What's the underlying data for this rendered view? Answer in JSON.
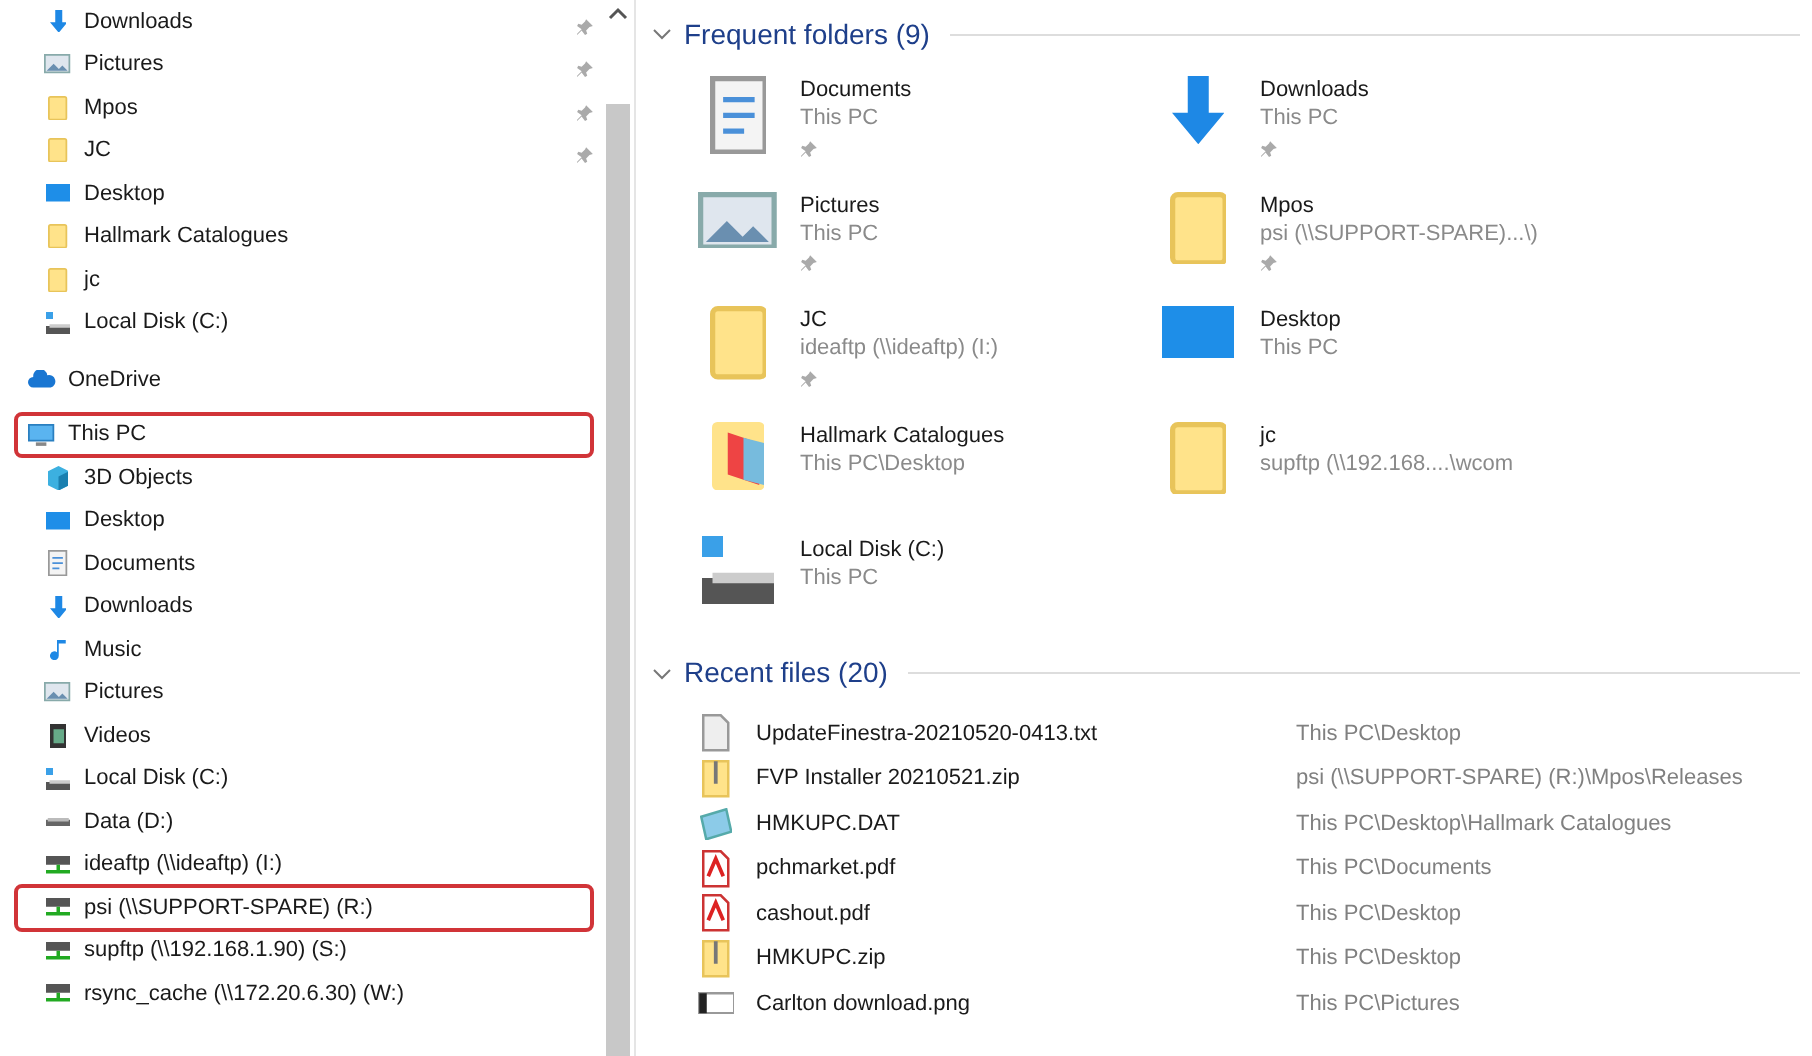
{
  "sidebar": {
    "quick_access": [
      {
        "label": "Downloads",
        "kind": "download",
        "pinned": true
      },
      {
        "label": "Pictures",
        "kind": "pictures",
        "pinned": true
      },
      {
        "label": "Mpos",
        "kind": "folder",
        "pinned": true
      },
      {
        "label": "JC",
        "kind": "folder",
        "pinned": true
      },
      {
        "label": "Desktop",
        "kind": "desktop",
        "pinned": false
      },
      {
        "label": "Hallmark Catalogues",
        "kind": "folder",
        "pinned": false
      },
      {
        "label": "jc",
        "kind": "folder",
        "pinned": false
      },
      {
        "label": "Local Disk (C:)",
        "kind": "disk",
        "pinned": false
      }
    ],
    "items": [
      {
        "label": "OneDrive",
        "kind": "cloud",
        "highlighted": false
      },
      {
        "label": "This PC",
        "kind": "pc",
        "highlighted": true,
        "children": [
          {
            "label": "3D Objects",
            "kind": "cube",
            "highlighted": false
          },
          {
            "label": "Desktop",
            "kind": "desktop",
            "highlighted": false
          },
          {
            "label": "Documents",
            "kind": "documents",
            "highlighted": false
          },
          {
            "label": "Downloads",
            "kind": "download",
            "highlighted": false
          },
          {
            "label": "Music",
            "kind": "music",
            "highlighted": false
          },
          {
            "label": "Pictures",
            "kind": "pictures",
            "highlighted": false
          },
          {
            "label": "Videos",
            "kind": "videos",
            "highlighted": false
          },
          {
            "label": "Local Disk (C:)",
            "kind": "disk",
            "highlighted": false
          },
          {
            "label": "Data (D:)",
            "kind": "drive",
            "highlighted": false
          },
          {
            "label": "ideaftp (\\\\ideaftp) (I:)",
            "kind": "netdrive",
            "highlighted": false
          },
          {
            "label": "psi (\\\\SUPPORT-SPARE) (R:)",
            "kind": "netdrive",
            "highlighted": true
          },
          {
            "label": "supftp (\\\\192.168.1.90) (S:)",
            "kind": "netdrive",
            "highlighted": false
          },
          {
            "label": "rsync_cache (\\\\172.20.6.30) (W:)",
            "kind": "netdrive",
            "highlighted": false
          }
        ]
      }
    ]
  },
  "frequent_folders": {
    "title": "Frequent folders (9)",
    "expanded": true,
    "items": [
      {
        "name": "Documents",
        "location": "This PC",
        "pinned": true,
        "kind": "documents"
      },
      {
        "name": "Downloads",
        "location": "This PC",
        "pinned": true,
        "kind": "download"
      },
      {
        "name": "Pictures",
        "location": "This PC",
        "pinned": true,
        "kind": "pictures"
      },
      {
        "name": "Mpos",
        "location": "psi (\\\\SUPPORT-SPARE)...\\)",
        "pinned": true,
        "kind": "folder"
      },
      {
        "name": "JC",
        "location": "ideaftp (\\\\ideaftp) (I:)",
        "pinned": true,
        "kind": "folder"
      },
      {
        "name": "Desktop",
        "location": "This PC",
        "pinned": false,
        "kind": "desktop"
      },
      {
        "name": "Hallmark Catalogues",
        "location": "This PC\\Desktop",
        "pinned": false,
        "kind": "book"
      },
      {
        "name": "jc",
        "location": "supftp (\\\\192.168....\\wcom",
        "pinned": false,
        "kind": "folder"
      },
      {
        "name": "Local Disk (C:)",
        "location": "This PC",
        "pinned": false,
        "kind": "disk"
      }
    ]
  },
  "recent_files": {
    "title": "Recent files (20)",
    "expanded": true,
    "items": [
      {
        "name": "UpdateFinestra-20210520-0413.txt",
        "location": "This PC\\Desktop",
        "kind": "txt"
      },
      {
        "name": "FVP Installer 20210521.zip",
        "location": "psi (\\\\SUPPORT-SPARE) (R:)\\Mpos\\Releases",
        "kind": "zip"
      },
      {
        "name": "HMKUPC.DAT",
        "location": "This PC\\Desktop\\Hallmark Catalogues",
        "kind": "dat"
      },
      {
        "name": "pchmarket.pdf",
        "location": "This PC\\Documents",
        "kind": "pdf"
      },
      {
        "name": "cashout.pdf",
        "location": "This PC\\Desktop",
        "kind": "pdf"
      },
      {
        "name": "HMKUPC.zip",
        "location": "This PC\\Desktop",
        "kind": "zip"
      },
      {
        "name": "Carlton download.png",
        "location": "This PC\\Pictures",
        "kind": "png"
      }
    ]
  }
}
